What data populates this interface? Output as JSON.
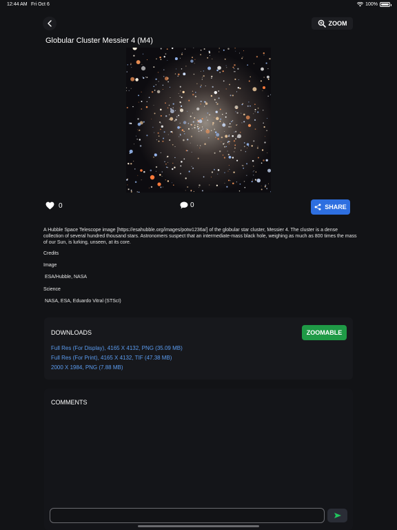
{
  "status_bar": {
    "time": "12:44 AM",
    "date": "Fri Oct 6",
    "battery": "100%"
  },
  "header": {
    "zoom_label": "ZOOM",
    "title": "Globular Cluster Messier 4 (M4)"
  },
  "actions": {
    "likes_count": "0",
    "comments_count": "0",
    "share_label": "SHARE"
  },
  "description": "A Hubble Space Telescope image [https://esahubble.org/images/potw1236a/] of the globular star cluster, Messier 4. The cluster is a dense collection of several hundred thousand stars. Astronomers suspect that an intermediate-mass black hole, weighing as much as 800 times the mass of our Sun, is lurking, unseen, at its core.",
  "credits": {
    "heading": "Credits",
    "image_label": "Image",
    "image_value": " ESA/Hubble, NASA",
    "science_label": "Science",
    "science_value": " NASA, ESA, Eduardo Vitral (STScI)"
  },
  "downloads": {
    "title": "DOWNLOADS",
    "zoomable_label": "ZOOMABLE",
    "links": [
      "Full Res (For Display), 4165 X 4132, PNG (35.09 MB)",
      "Full Res (For Print), 4165 X 4132, TIF (47.38 MB)",
      "2000 X 1984, PNG (7.88 MB)"
    ]
  },
  "comments": {
    "title": "COMMENTS",
    "input_value": "",
    "input_placeholder": ""
  },
  "colors": {
    "background": "#121316",
    "accent_blue": "#2e6fe0",
    "accent_green": "#1f9a46",
    "link_blue": "#5b9cf0",
    "send_icon_green": "#21c55d"
  },
  "icons": {
    "back": "chevron-left-icon",
    "zoom": "magnify-plus-icon",
    "like": "heart-icon",
    "comment": "speech-bubble-icon",
    "share": "share-icon",
    "send": "send-icon",
    "wifi": "wifi-icon",
    "battery": "battery-icon"
  }
}
